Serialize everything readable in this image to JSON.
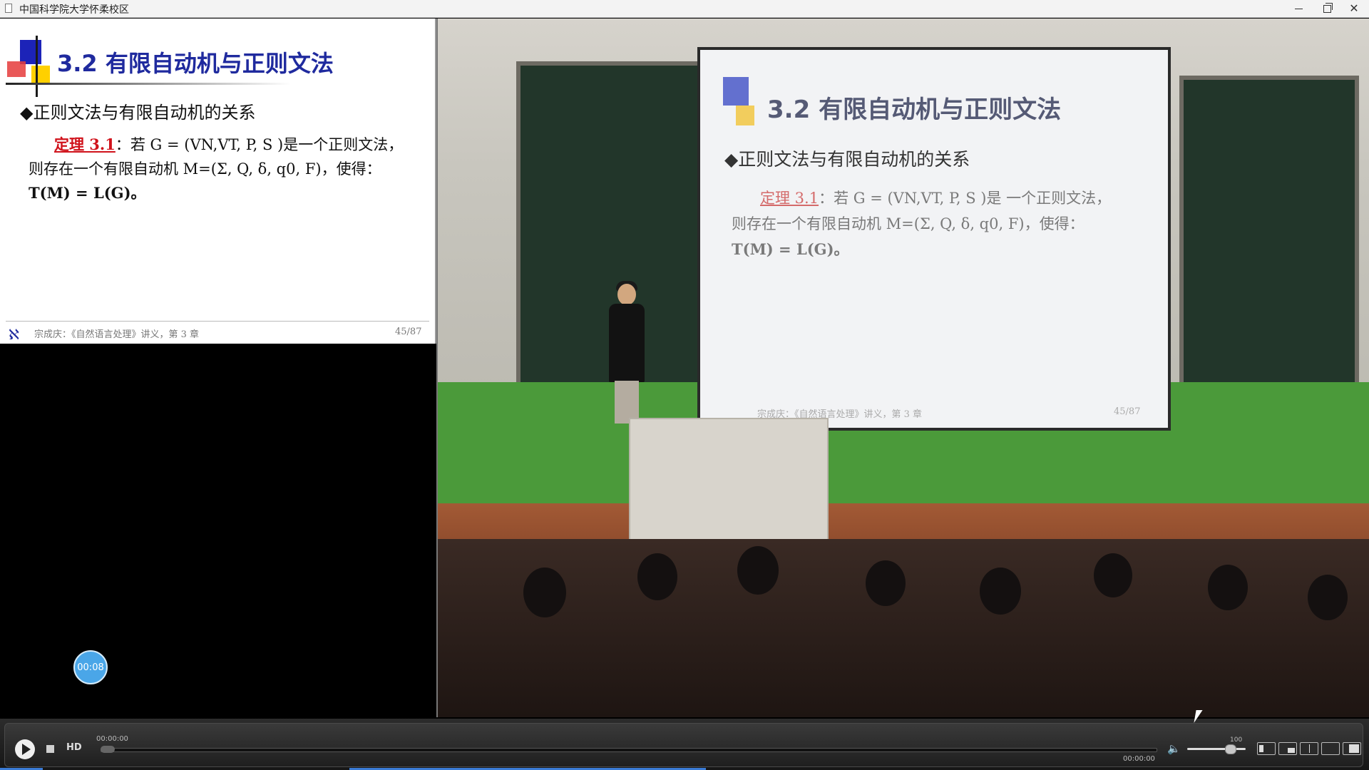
{
  "window": {
    "title": "中国科学院大学怀柔校区"
  },
  "slide": {
    "title": "3.2 有限自动机与正则文法",
    "bullet": "◆正则文法与有限自动机的关系",
    "theorem_label": "定理 3.1",
    "body_line1": "：若 G = (VN,VT, P, S )是一个正则文法，",
    "body_line2": "则存在一个有限自动机 M=(Σ, Q, δ, q0, F)，使得：",
    "body_line3": "T(M) = L(G)。",
    "footer": "宗成庆：《自然语言处理》讲义，第 3 章",
    "page": "45/87"
  },
  "video_slide": {
    "title": "3.2 有限自动机与正则文法",
    "bullet": "◆正则文法与有限自动机的关系",
    "theorem_label": "定理 3.1",
    "body_line1": "：若 G = (VN,VT, P, S )是 一个正则文法，",
    "body_line2": "则存在一个有限自动机 M=(Σ, Q, δ, q0, F)，使得：",
    "body_line3": "T(M) = L(G)。",
    "footer": "宗成庆：《自然语言处理》讲义，第 3 章",
    "page": "45/87"
  },
  "timer_badge": "00:08",
  "player": {
    "hd_label": "HD",
    "time_elapsed": "00:00:00",
    "time_total": "00:00:00",
    "volume_max": "100",
    "volume_level": 0.8,
    "seek_position": 0.0,
    "icons": {
      "play": "play-icon",
      "stop": "stop-icon",
      "volume": "speaker-icon",
      "layouts": [
        "layout-pip-icon",
        "layout-side-icon",
        "layout-split-icon",
        "layout-single-icon",
        "layout-full-icon"
      ]
    }
  },
  "colors": {
    "title_blue": "#1f2a9e",
    "theorem_red": "#d0121b",
    "timer_blue": "#4aa6e8"
  }
}
